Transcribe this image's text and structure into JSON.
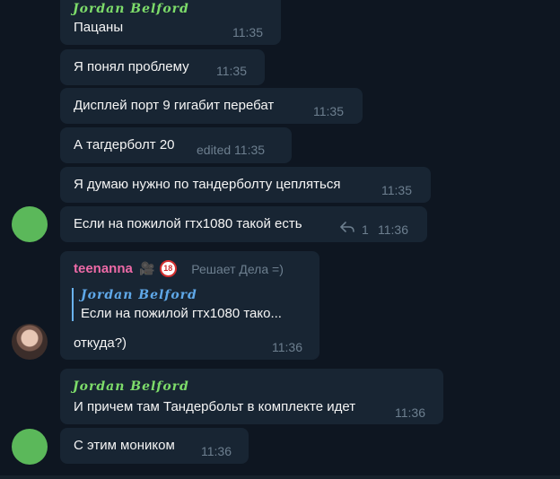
{
  "messages": [
    {
      "sender": "𝑱𝒐𝒓𝒅𝒂𝒏 𝑩𝒆𝒍𝒇𝒐𝒓𝒅",
      "text": "Пацаны",
      "time": "11:35"
    },
    {
      "text": "Я понял проблему",
      "time": "11:35"
    },
    {
      "text": "Дисплей порт 9 гигабит перебат",
      "time": "11:35"
    },
    {
      "text": "А тагдерболт 20",
      "time": "edited 11:35"
    },
    {
      "text": "Я думаю нужно по тандерболту цепляться",
      "time": "11:35"
    },
    {
      "text": "Если на пожилой гтх1080 такой есть",
      "replies": "1",
      "time": "11:36"
    },
    {
      "sender": "teenanna",
      "sender_status": "Решает Дела =)",
      "reply_to_sender": "𝑱𝒐𝒓𝒅𝒂𝒏 𝑩𝒆𝒍𝒇𝒐𝒓𝒅",
      "reply_to_text": "Если на пожилой гтх1080 тако...",
      "text": "откуда?)",
      "time": "11:36"
    },
    {
      "sender": "𝑱𝒐𝒓𝒅𝒂𝒏 𝑩𝒆𝒍𝒇𝒐𝒓𝒅",
      "text": "И причем там Тандербольт в комплекте идет",
      "time": "11:36"
    },
    {
      "text": "С этим моником",
      "time": "11:36"
    }
  ],
  "badges": {
    "camera": "🎥",
    "age": "18"
  },
  "colors": {
    "background": "#0e1621",
    "bubble": "#182533",
    "sender_green": "#7ddc6a",
    "sender_pink": "#ee6aa7",
    "reply_accent": "#6ab3f3"
  }
}
